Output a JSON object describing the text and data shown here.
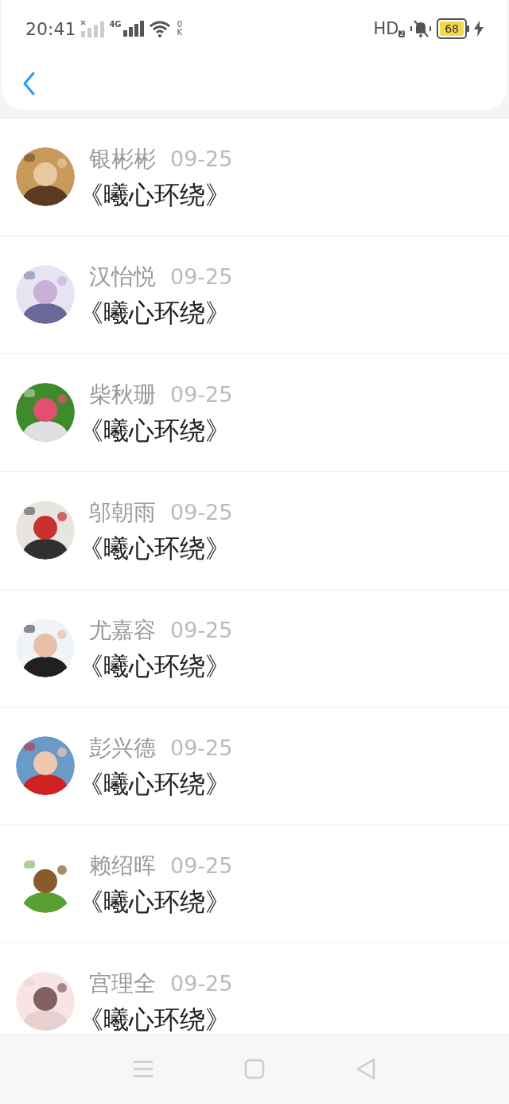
{
  "status_bar": {
    "time": "20:41",
    "network_type": "4G",
    "speed_value": "0",
    "speed_unit": "K",
    "hd_label": "HD",
    "hd_index": "2",
    "battery": "68"
  },
  "messages": [
    {
      "name": "银彬彬",
      "date": "09-25",
      "title": "《曦心环绕》"
    },
    {
      "name": "汉怡悦",
      "date": "09-25",
      "title": "《曦心环绕》"
    },
    {
      "name": "柴秋珊",
      "date": "09-25",
      "title": "《曦心环绕》"
    },
    {
      "name": "邬朝雨",
      "date": "09-25",
      "title": "《曦心环绕》"
    },
    {
      "name": "尤嘉容",
      "date": "09-25",
      "title": "《曦心环绕》"
    },
    {
      "name": "彭兴德",
      "date": "09-25",
      "title": "《曦心环绕》"
    },
    {
      "name": "赖绍晖",
      "date": "09-25",
      "title": "《曦心环绕》"
    },
    {
      "name": "宫理全",
      "date": "09-25",
      "title": "《曦心环绕》"
    }
  ]
}
